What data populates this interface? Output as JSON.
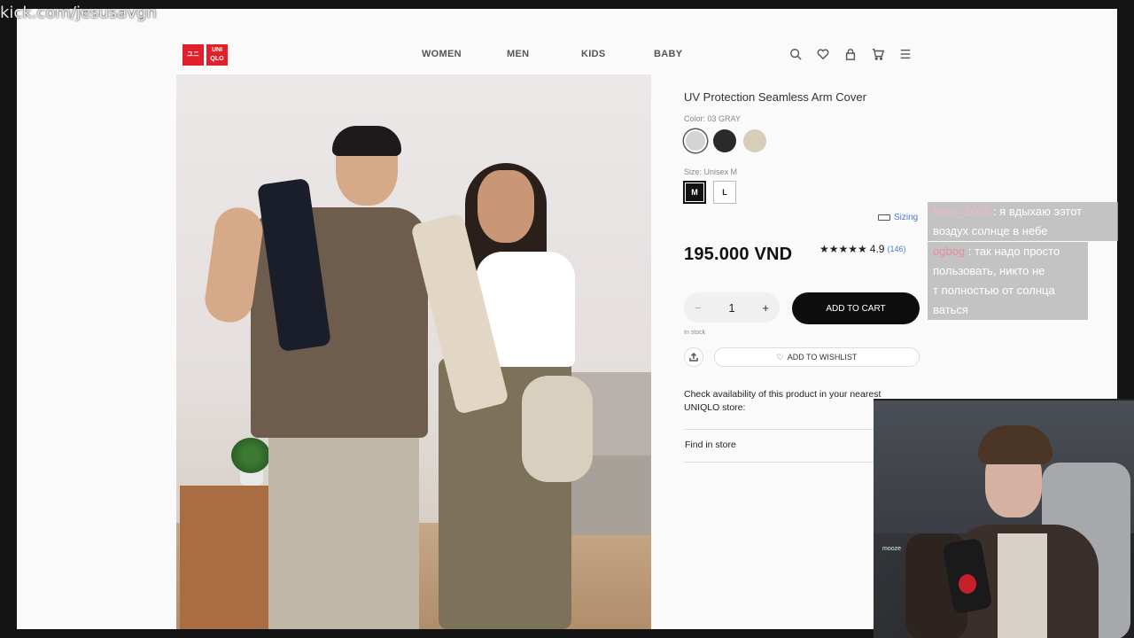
{
  "overlay": {
    "url_text": "kick.com/jesusavgn"
  },
  "header": {
    "logo_top": "ユニ",
    "logo_bottom": "UNI QLO",
    "nav": [
      "WOMEN",
      "MEN",
      "KIDS",
      "BABY"
    ],
    "icons": [
      "search-icon",
      "heart-icon",
      "user-icon",
      "cart-icon",
      "menu-icon"
    ]
  },
  "product": {
    "title": "UV Protection Seamless Arm Cover",
    "color_label": "Color: 03 GRAY",
    "colors": [
      {
        "name": "gray",
        "hex": "#d4d4d4",
        "selected": true
      },
      {
        "name": "black",
        "hex": "#2a2a2a",
        "selected": false
      },
      {
        "name": "beige",
        "hex": "#d8cdb8",
        "selected": false
      }
    ],
    "size_label": "Size: Unisex M",
    "sizes": [
      {
        "label": "M",
        "selected": true
      },
      {
        "label": "L",
        "selected": false
      }
    ],
    "sizing_link": "Sizing",
    "price": "195.000 VND",
    "rating_stars": "★★★★★",
    "rating_value": "4.9",
    "rating_count": "(146)",
    "quantity": "1",
    "minus": "−",
    "plus": "+",
    "add_to_cart": "ADD TO CART",
    "stock": "In stock",
    "wishlist": "ADD TO WISHLIST",
    "check_availability": "Check availability of this product in your nearest UNIQLO store:",
    "find_in_store": "Find in store"
  },
  "chat": [
    {
      "user": "NiKo_2004",
      "lines": [
        " : я вдыхаю ээтот",
        "воздух солнце в небе"
      ]
    },
    {
      "user": "ogbog",
      "lines": [
        " : так надо просто",
        "пользовать, никто не",
        "т полностью от солнца",
        "ваться"
      ]
    }
  ],
  "webcam": {
    "mic_label": "mooze"
  }
}
